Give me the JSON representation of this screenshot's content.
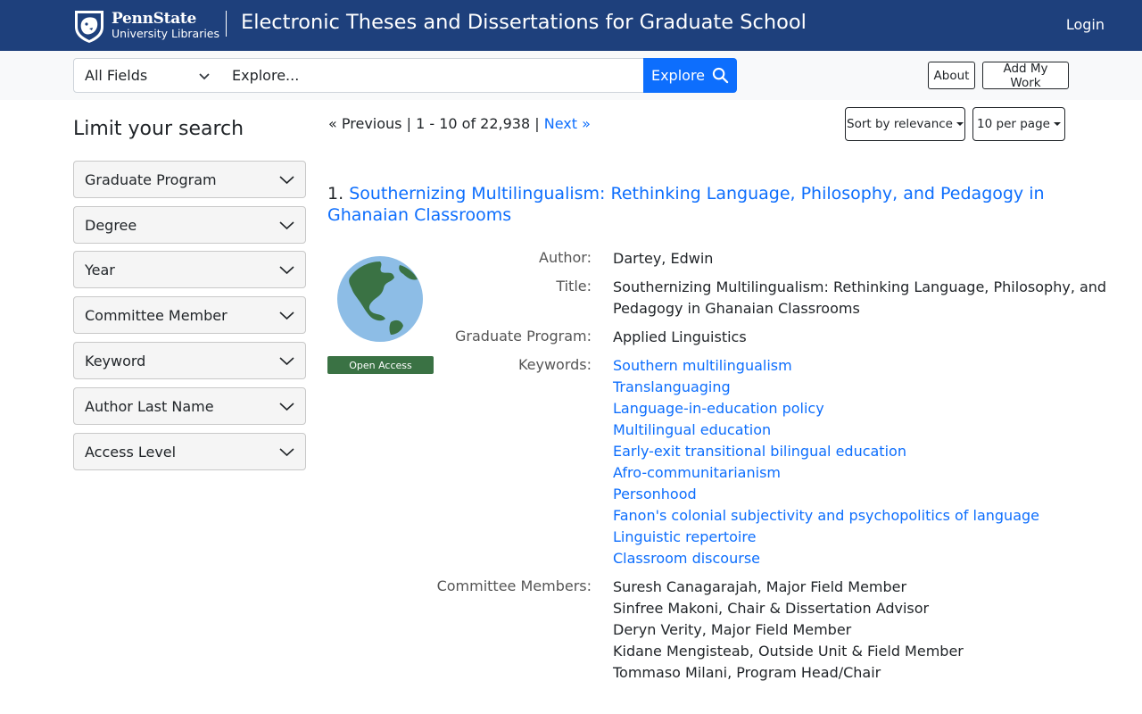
{
  "header": {
    "logo_line1": "PennState",
    "logo_line2": "University Libraries",
    "app_title": "Electronic Theses and Dissertations for Graduate School",
    "login_label": "Login"
  },
  "search": {
    "field_select": "All Fields",
    "placeholder": "Explore...",
    "explore_label": "Explore",
    "about_label": "About",
    "add_work_label": "Add My Work"
  },
  "sidebar": {
    "title": "Limit your search",
    "facets": [
      "Graduate Program",
      "Degree",
      "Year",
      "Committee Member",
      "Keyword",
      "Author Last Name",
      "Access Level"
    ]
  },
  "results": {
    "previous": "« Previous",
    "range": "1 - 10 of 22,938",
    "next": "Next »",
    "sort_label": "Sort by relevance",
    "per_page_label": "10 per page"
  },
  "record": {
    "number": "1.",
    "title": "Southernizing Multilingualism: Rethinking Language, Philosophy, and Pedagogy in Ghanaian Classrooms",
    "badge": "Open Access",
    "author_label": "Author:",
    "author": "Dartey, Edwin",
    "title_label": "Title:",
    "title_line1": "Southernizing Multilingualism: Rethinking Language, Philosophy, and",
    "title_line2": "Pedagogy in Ghanaian Classrooms",
    "program_label": "Graduate Program:",
    "program": "Applied Linguistics",
    "keywords_label": "Keywords:",
    "keywords": [
      "Southern multilingualism",
      "Translanguaging",
      "Language-in-education policy",
      "Multilingual education",
      "Early-exit transitional bilingual education",
      "Afro-communitarianism",
      "Personhood",
      "Fanon's colonial subjectivity and psychopolitics of language",
      "Linguistic repertoire",
      "Classroom discourse"
    ],
    "committee_label": "Committee Members:",
    "committee": [
      "Suresh Canagarajah, Major Field Member",
      "Sinfree Makoni, Chair & Dissertation Advisor",
      "Deryn Verity, Major Field Member",
      "Kidane Mengisteab, Outside Unit & Field Member",
      "Tommaso Milani, Program Head/Chair"
    ]
  },
  "colors": {
    "header_bg": "#1e407c",
    "link": "#0d6efd",
    "badge": "#3a7244",
    "button_primary": "#0d6efd"
  }
}
